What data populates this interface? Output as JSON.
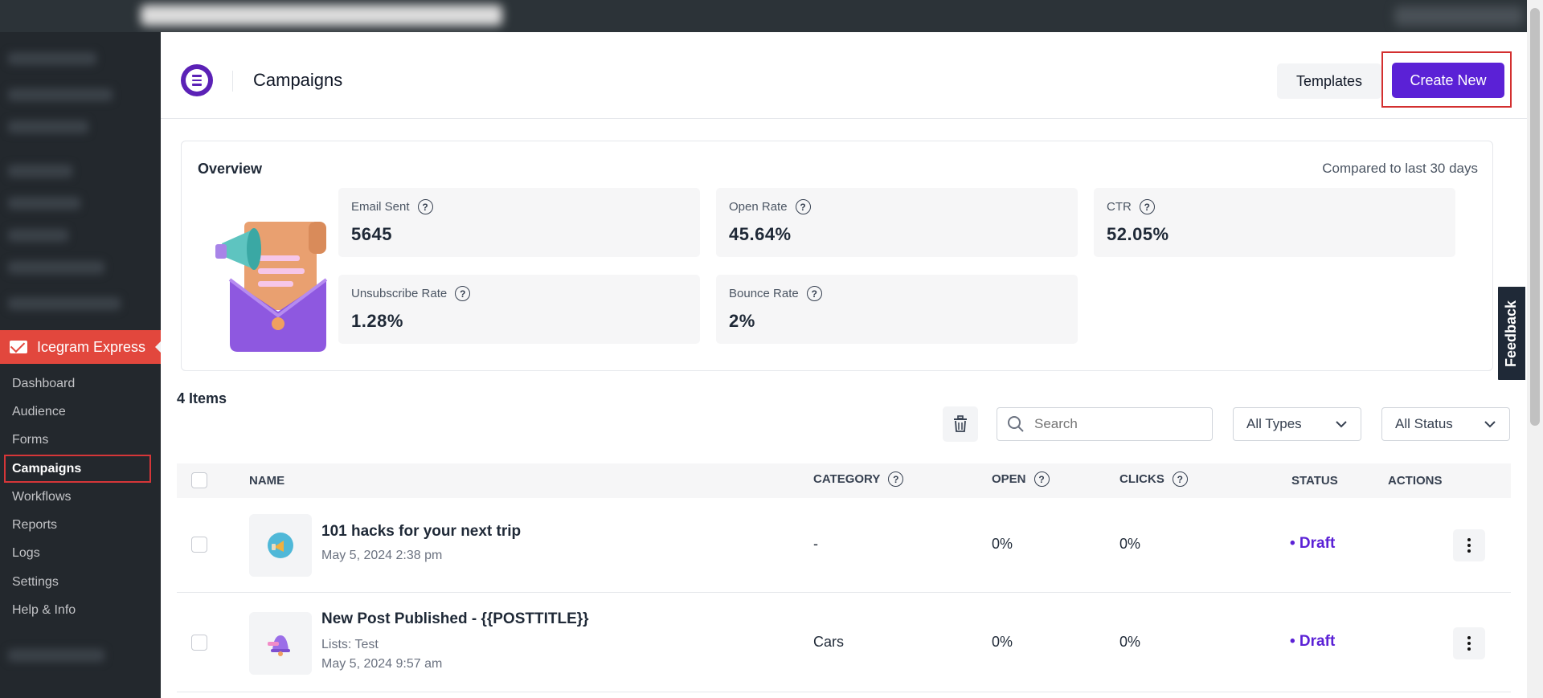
{
  "sidebar": {
    "brand": "Icegram Express",
    "items": [
      {
        "label": "Dashboard"
      },
      {
        "label": "Audience"
      },
      {
        "label": "Forms"
      },
      {
        "label": "Campaigns",
        "active": true
      },
      {
        "label": "Workflows"
      },
      {
        "label": "Reports"
      },
      {
        "label": "Logs"
      },
      {
        "label": "Settings"
      },
      {
        "label": "Help & Info"
      }
    ]
  },
  "header": {
    "title": "Campaigns",
    "templates_label": "Templates",
    "create_label": "Create New"
  },
  "overview": {
    "title": "Overview",
    "compare_text": "Compared to last 30 days",
    "stats": [
      {
        "label": "Email Sent",
        "value": "5645"
      },
      {
        "label": "Open Rate",
        "value": "45.64%"
      },
      {
        "label": "CTR",
        "value": "52.05%"
      },
      {
        "label": "Unsubscribe Rate",
        "value": "1.28%"
      },
      {
        "label": "Bounce Rate",
        "value": "2%"
      }
    ]
  },
  "list": {
    "count_label": "4 Items",
    "search_placeholder": "Search",
    "type_filter": "All Types",
    "status_filter": "All Status"
  },
  "table": {
    "columns": {
      "name": "NAME",
      "category": "CATEGORY",
      "open": "OPEN",
      "clicks": "CLICKS",
      "status": "STATUS",
      "actions": "ACTIONS"
    },
    "rows": [
      {
        "name": "101 hacks for your next trip",
        "meta1": "May 5, 2024 2:38 pm",
        "meta2": "",
        "category": "-",
        "open": "0%",
        "clicks": "0%",
        "status": "• Draft"
      },
      {
        "name": "New Post Published - {{POSTTITLE}}",
        "meta1": "Lists: Test",
        "meta2": "May 5, 2024 9:57 am",
        "category": "Cars",
        "open": "0%",
        "clicks": "0%",
        "status": "• Draft"
      }
    ]
  },
  "feedback_label": "Feedback",
  "colors": {
    "accent": "#5b21d6",
    "brand_red": "#e2473d",
    "sidebar_bg": "#23282d",
    "highlight": "#d32f2f"
  }
}
